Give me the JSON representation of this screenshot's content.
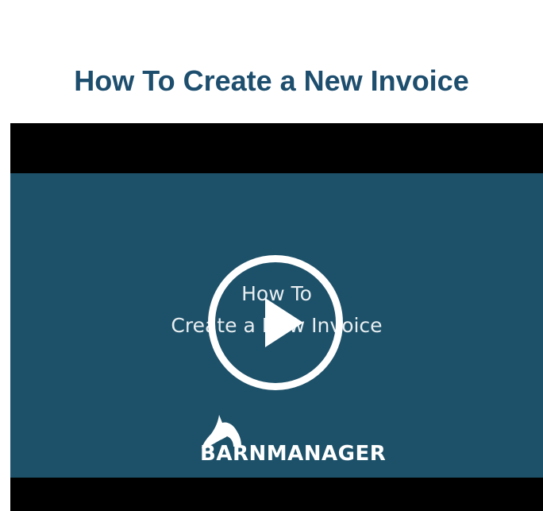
{
  "page": {
    "title": "How To Create a New Invoice"
  },
  "video": {
    "line1": "How To",
    "line2": "Create a New Invoice",
    "brand": "BARNMANAGER",
    "play_icon": "play-icon",
    "logo_icon": "horse-head-icon"
  },
  "colors": {
    "title": "#1d4e6e",
    "video_background": "#1d5169",
    "letterbox": "#000000",
    "play_button": "#ffffff"
  }
}
